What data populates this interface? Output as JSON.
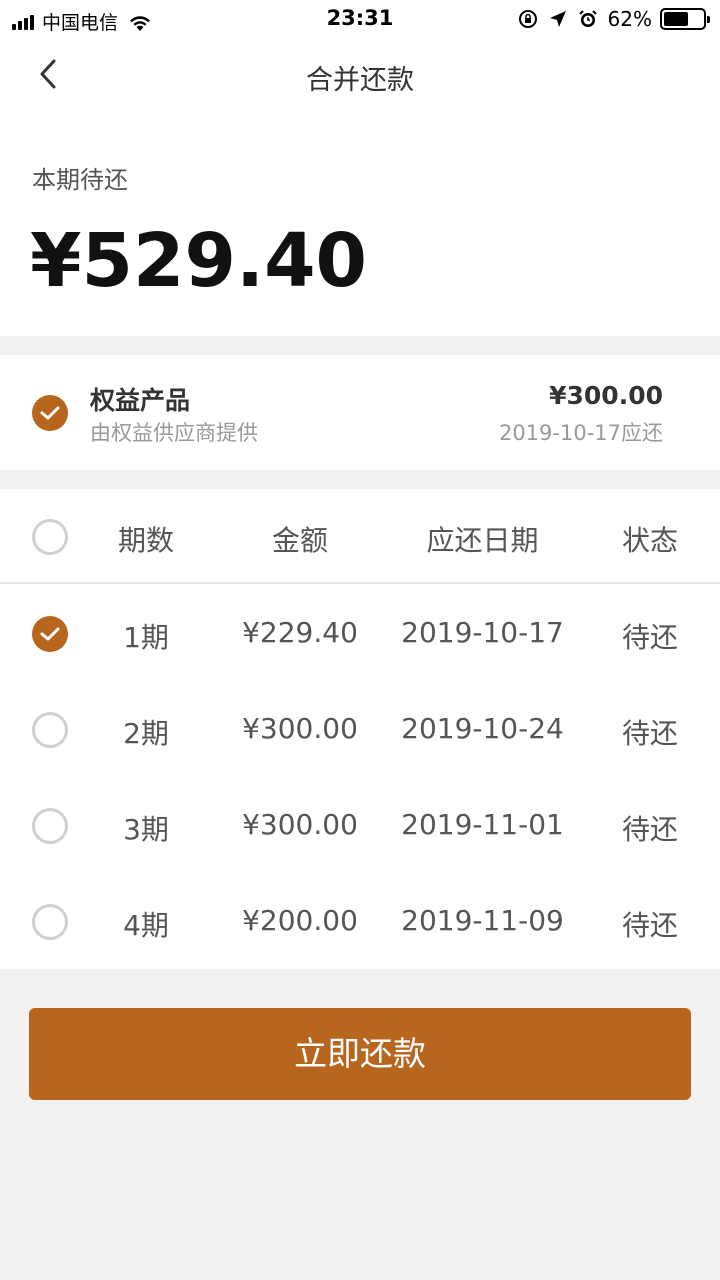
{
  "status_bar": {
    "carrier": "中国电信",
    "time": "23:31",
    "battery_percent": "62%",
    "battery_level": 0.62,
    "icons": [
      "signal-icon",
      "wifi-icon",
      "orientation-lock-icon",
      "location-icon",
      "alarm-icon",
      "battery-icon"
    ]
  },
  "nav": {
    "title": "合并还款",
    "back_icon": "chevron-left-icon"
  },
  "due": {
    "label": "本期待还",
    "amount": "¥529.40"
  },
  "product": {
    "checked": true,
    "name": "权益产品",
    "subtitle": "由权益供应商提供",
    "amount": "¥300.00",
    "due_date": "2019-10-17应还"
  },
  "table": {
    "select_all_checked": false,
    "headers": [
      "期数",
      "金额",
      "应还日期",
      "状态"
    ],
    "rows": [
      {
        "checked": true,
        "period": "1期",
        "amount": "¥229.40",
        "date": "2019-10-17",
        "status": "待还"
      },
      {
        "checked": false,
        "period": "2期",
        "amount": "¥300.00",
        "date": "2019-10-24",
        "status": "待还"
      },
      {
        "checked": false,
        "period": "3期",
        "amount": "¥300.00",
        "date": "2019-11-01",
        "status": "待还"
      },
      {
        "checked": false,
        "period": "4期",
        "amount": "¥200.00",
        "date": "2019-11-09",
        "status": "待还"
      }
    ]
  },
  "pay_button": {
    "label": "立即还款"
  },
  "colors": {
    "accent": "#b8651e",
    "background": "#f2f2f2",
    "muted": "#999999"
  }
}
